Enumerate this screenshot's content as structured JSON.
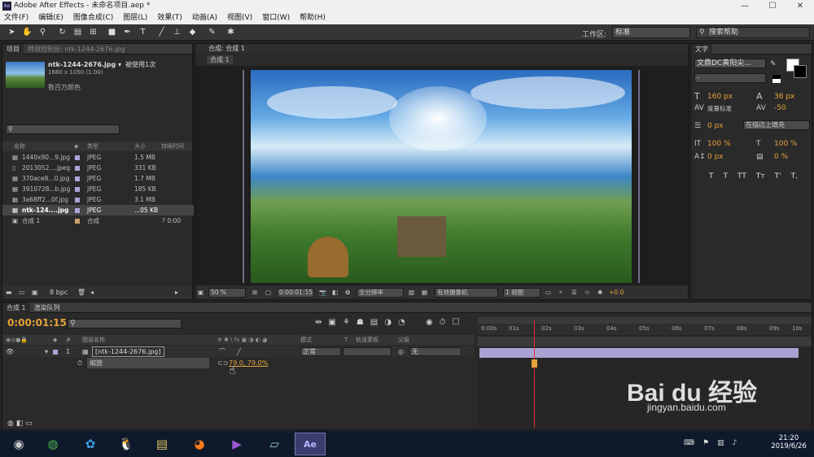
{
  "window": {
    "title": "Adobe After Effects - 未命名项目.aep *",
    "app_icon": "Ae",
    "min": "—",
    "max": "☐",
    "close": "✕"
  },
  "menu": [
    "文件(F)",
    "编辑(E)",
    "图像合成(C)",
    "图层(L)",
    "效果(T)",
    "动画(A)",
    "视图(V)",
    "窗口(W)",
    "帮助(H)"
  ],
  "toolbar": {
    "workspace_label": "工作区:",
    "workspace_value": "标准",
    "search_placeholder": "搜索帮助",
    "search_icon": "search-icon"
  },
  "project": {
    "tab_project": "项目",
    "tab_effects": "特效控制台: ntk-1244-2676.jpg",
    "file_name": "ntk-1244-2676.jpg ▾",
    "usage": "被使用1次",
    "dims": "1680 x 1050 (1.00)",
    "colors": "数百万颜色",
    "columns": {
      "name": "名称",
      "type": "类型",
      "size": "大小",
      "duration": "持续时间"
    },
    "items": [
      {
        "name": "1440x90...9.jpg",
        "type": "JPEG",
        "size": "1.5 MB",
        "dur": ""
      },
      {
        "name": "2013052....jpeg",
        "type": "JPEG",
        "size": "331 KB",
        "dur": ""
      },
      {
        "name": "370ace8...0.jpg",
        "type": "JPEG",
        "size": "1.7 MB",
        "dur": ""
      },
      {
        "name": "3910728...b.jpg",
        "type": "JPEG",
        "size": "185 KB",
        "dur": ""
      },
      {
        "name": "3a68ff2...0f.jpg",
        "type": "JPEG",
        "size": "3.1 MB",
        "dur": ""
      },
      {
        "name": "ntk-124....jpg",
        "type": "JPEG",
        "size": "...05 KB",
        "dur": ""
      },
      {
        "name": "合成 1",
        "type": "合成",
        "size": "",
        "dur": "? 0:00"
      }
    ],
    "bpc": "8 bpc"
  },
  "composition": {
    "tab": "合成: 合成 1",
    "subtab": "合成 1",
    "zoom": "50 %",
    "timecode": "0:00:01:15",
    "resolution": "全分辨率",
    "camera": "有效摄像机",
    "views": "1 视图",
    "exposure": "+0.0"
  },
  "text_panel": {
    "title": "文字",
    "font": "文鼎DC黄阳尖...",
    "style": "-",
    "size": "160 px",
    "leading": "36 px",
    "kerning": "度量标准",
    "tracking": "-50",
    "stroke": "0 px",
    "stroke_mode": "在描边上填充",
    "vscale": "100 %",
    "hscale": "100 %",
    "baseline": "0 px",
    "tsume": "0 %",
    "styles": [
      "T",
      "T",
      "TT",
      "Tт",
      "T'",
      "T,"
    ]
  },
  "timeline": {
    "tab_comp": "合成 1",
    "tab_render": "渲染队列",
    "timecode": "0:00:01:15",
    "headers": {
      "layer_name": "图层名称",
      "mode": "模式",
      "t": "T",
      "track_matte": "轨道蒙板",
      "parent": "父级"
    },
    "layer": {
      "num": "1",
      "name": "[ntk-1244-2676.jpg]",
      "mode": "正常",
      "parent": "无"
    },
    "property": {
      "name": "缩放",
      "value": "79.0, 79.0%"
    },
    "ruler": [
      "0:00s",
      "01s",
      "02s",
      "03s",
      "04s",
      "05s",
      "06s",
      "07s",
      "08s",
      "09s",
      "10s"
    ],
    "playhead_fraction": 0.163
  },
  "taskbar": {
    "time": "21:20",
    "date": "2019/6/26"
  },
  "watermark": {
    "brand": "Bai du 经验",
    "url": "jingyan.baidu.com"
  }
}
